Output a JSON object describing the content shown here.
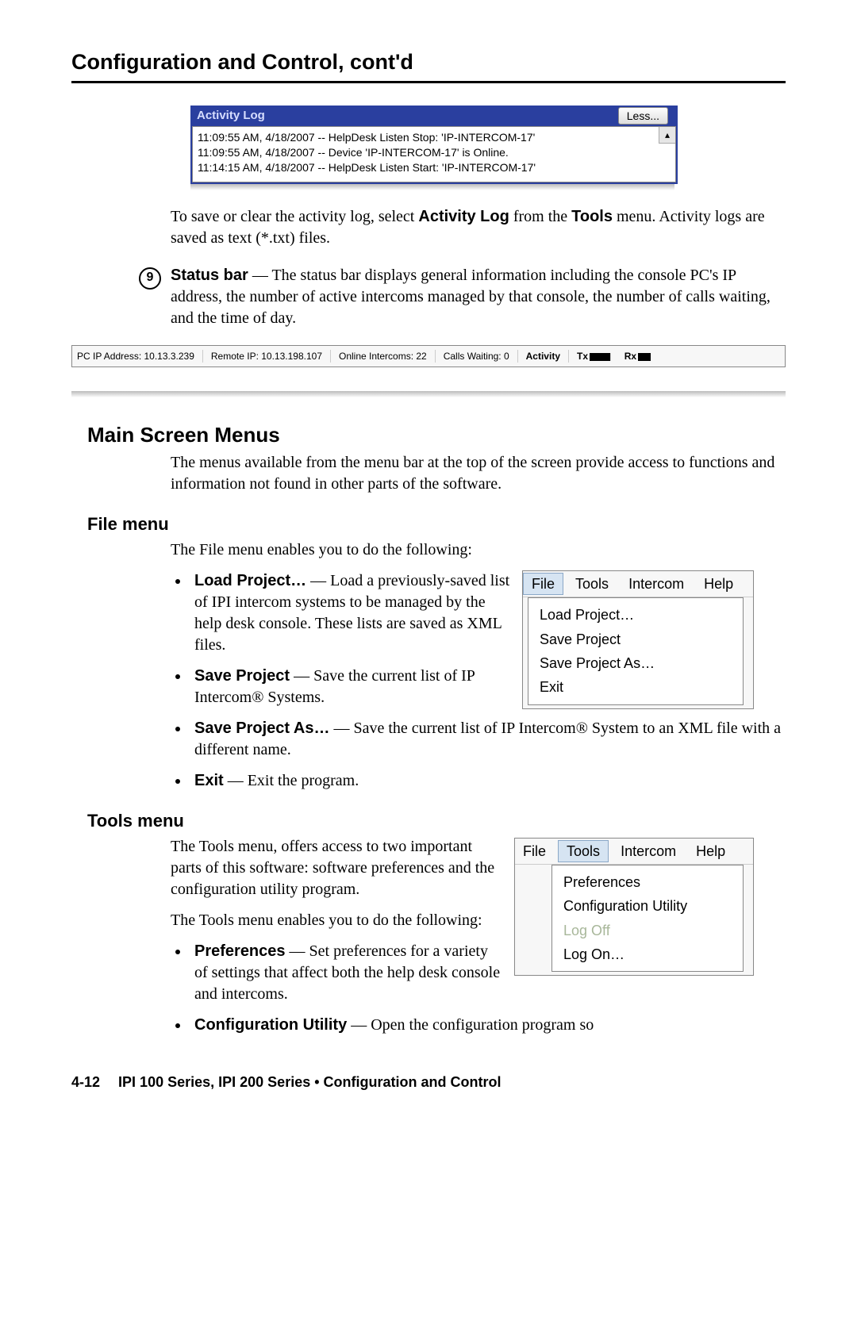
{
  "pageTitle": "Configuration and Control, cont'd",
  "activityLog": {
    "title": "Activity Log",
    "lessBtn": "Less...",
    "lines": [
      "11:09:55 AM, 4/18/2007 -- HelpDesk Listen Stop: 'IP-INTERCOM-17'",
      "11:09:55 AM, 4/18/2007 -- Device 'IP-INTERCOM-17' is Online.",
      "11:14:15 AM, 4/18/2007 -- HelpDesk Listen Start: 'IP-INTERCOM-17'"
    ]
  },
  "para1a": "To save or clear the activity log, select ",
  "para1b": "Activity Log",
  "para1c": " from the ",
  "para1d": "Tools",
  "para1e": " menu.  Activity logs are saved as text (*.txt) files.",
  "circleNum": "9",
  "statusTerm": "Status bar",
  "statusText": " — The status bar displays general information including the console PC's IP address, the number of active intercoms managed by that console, the number of calls waiting, and the time of day.",
  "statusBar": {
    "pcip": "PC IP Address: 10.13.3.239",
    "remote": "Remote IP: 10.13.198.107",
    "online": "Online Intercoms: 22",
    "calls": "Calls Waiting: 0",
    "activity": "Activity",
    "tx": "Tx",
    "rx": "Rx"
  },
  "h2": "Main Screen Menus",
  "mainIntro": "The menus available from the menu bar at the top of the screen provide access to functions and information not found in other parts of the software.",
  "fileMenuHeading": "File menu",
  "fileIntro": "The File menu enables you to do the following:",
  "fileMenuFig": {
    "bar": [
      "File",
      "Tools",
      "Intercom",
      "Help"
    ],
    "items": [
      "Load Project…",
      "Save Project",
      "Save Project As…",
      "Exit"
    ]
  },
  "fileBullets": {
    "b1t": "Load Project…",
    "b1r": " — Load a previously-saved list of IPI intercom systems to be managed by the help desk console.  These lists are saved as XML files.",
    "b2t": "Save Project",
    "b2r": " — Save the current list of IP Intercom® Systems.",
    "b3t": "Save Project As…",
    "b3r": " — Save the current list of IP Intercom® System to an XML file with a different name.",
    "b4t": "Exit",
    "b4r": " — Exit the program."
  },
  "toolsMenuHeading": "Tools menu",
  "toolsIntro1": "The Tools menu, offers access to two important parts of this software: software preferences and the configuration utility program.",
  "toolsIntro2": "The Tools menu enables you to do the following:",
  "toolsMenuFig": {
    "bar": [
      "File",
      "Tools",
      "Intercom",
      "Help"
    ],
    "items": [
      "Preferences",
      "Configuration Utility",
      "Log Off",
      "Log On…"
    ]
  },
  "toolsBullets": {
    "b1t": "Preferences",
    "b1r": " — Set preferences for a variety of settings that affect both the help desk console and intercoms.",
    "b2t": "Configuration Utility",
    "b2r": " — Open the configuration program so"
  },
  "footer": {
    "page": "4-12",
    "text": "IPI 100 Series, IPI 200 Series • Configuration and Control"
  }
}
